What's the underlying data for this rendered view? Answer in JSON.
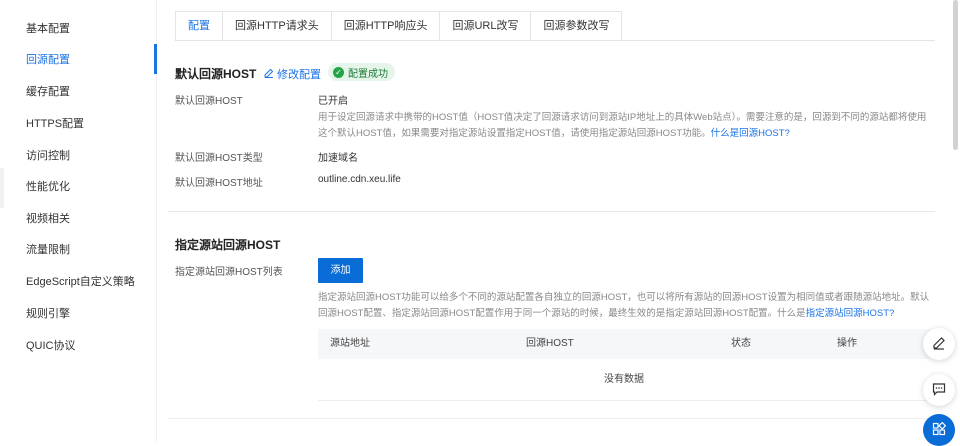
{
  "sidebar": {
    "items": [
      {
        "label": "基本配置"
      },
      {
        "label": "回源配置"
      },
      {
        "label": "缓存配置"
      },
      {
        "label": "HTTPS配置"
      },
      {
        "label": "访问控制"
      },
      {
        "label": "性能优化"
      },
      {
        "label": "视频相关"
      },
      {
        "label": "流量限制"
      },
      {
        "label": "EdgeScript自定义策略"
      },
      {
        "label": "规则引擎"
      },
      {
        "label": "QUIC协议"
      }
    ],
    "active_index": 1
  },
  "tabs": [
    {
      "label": "配置"
    },
    {
      "label": "回源HTTP请求头"
    },
    {
      "label": "回源HTTP响应头"
    },
    {
      "label": "回源URL改写"
    },
    {
      "label": "回源参数改写"
    }
  ],
  "default_host": {
    "title": "默认回源HOST",
    "edit_label": "修改配置",
    "badge": "配置成功",
    "rows": {
      "status_label": "默认回源HOST",
      "status_value": "已开启",
      "type_label": "默认回源HOST类型",
      "type_value": "加速域名",
      "address_label": "默认回源HOST地址",
      "address_value": "outline.cdn.xeu.life"
    },
    "description": "用于设定回源请求中携带的HOST值（HOST值决定了回源请求访问到源站IP地址上的具体Web站点）。需要注意的是，回源到不同的源站都将使用这个默认HOST值，如果需要对指定源站设置指定HOST值，请使用指定源站回源HOST功能。",
    "description_link": "什么是回源HOST?"
  },
  "specified_host": {
    "title": "指定源站回源HOST",
    "list_label": "指定源站回源HOST列表",
    "add_label": "添加",
    "description": "指定源站回源HOST功能可以给多个不同的源站配置各自独立的回源HOST，也可以将所有源站的回源HOST设置为相同值或者跟随源站地址。默认回源HOST配置、指定源站回源HOST配置作用于同一个源站的时候，最终生效的是指定源站回源HOST配置。什么是",
    "description_link": "指定源站回源HOST?",
    "table": {
      "columns": [
        "源站地址",
        "回源HOST",
        "状态",
        "操作"
      ],
      "empty_text": "没有数据"
    }
  },
  "colors": {
    "accent": "#1a73e8",
    "button": "#0a6cd6",
    "success_bg": "#e6f5ea",
    "success": "#22a447"
  },
  "float_icons": [
    "edit-icon",
    "message-icon",
    "apps-icon"
  ]
}
